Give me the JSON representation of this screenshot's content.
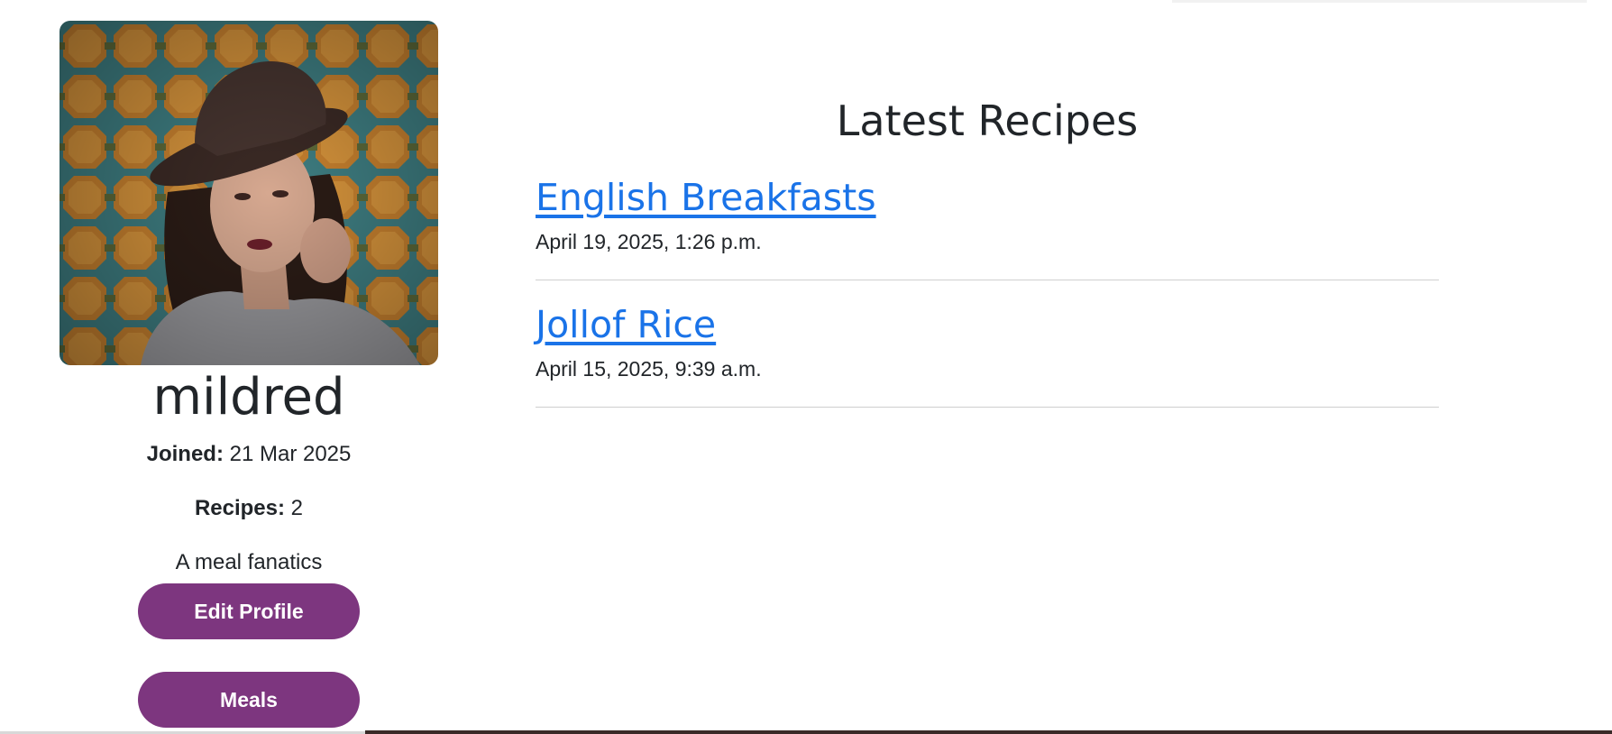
{
  "profile": {
    "username": "mildred",
    "joined_label": "Joined:",
    "joined_value": "21 Mar 2025",
    "recipes_label": "Recipes:",
    "recipes_value": "2",
    "bio": "A meal fanatics",
    "edit_button": "Edit Profile",
    "meals_button": "Meals"
  },
  "recipes": {
    "heading": "Latest Recipes",
    "items": [
      {
        "title": "English Breakfasts",
        "date": "April 19, 2025, 1:26 p.m."
      },
      {
        "title": "Jollof Rice",
        "date": "April 15, 2025, 9:39 a.m."
      }
    ]
  },
  "colors": {
    "button": "#7d367f",
    "link": "#1a73e8",
    "text": "#212529"
  }
}
